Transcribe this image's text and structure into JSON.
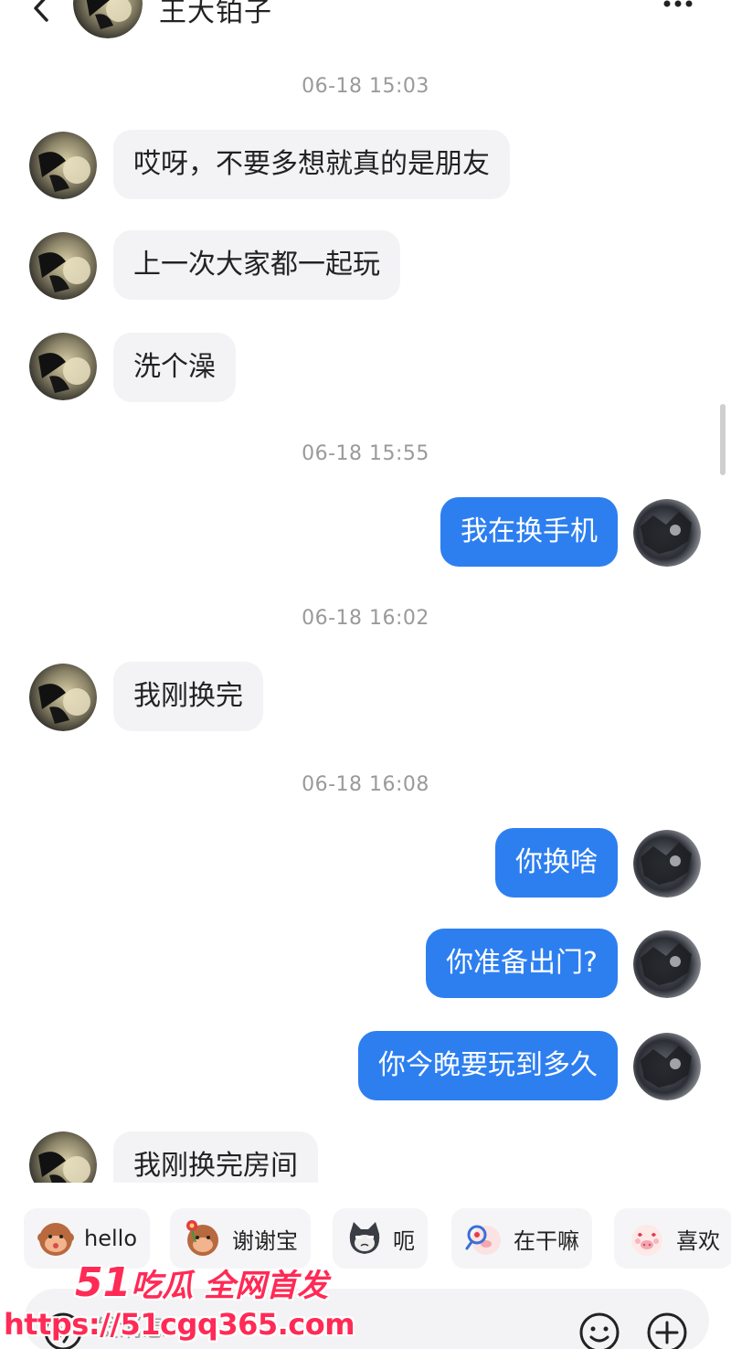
{
  "header": {
    "title": "王大铂子",
    "back_icon": "chevron-left-icon",
    "more_icon": "more-dots-icon"
  },
  "messages": [
    {
      "type": "timestamp",
      "text": "06-18 15:03"
    },
    {
      "type": "in",
      "text": "哎呀，不要多想就真的是朋友"
    },
    {
      "type": "in",
      "text": "上一次大家都一起玩"
    },
    {
      "type": "in",
      "text": "洗个澡"
    },
    {
      "type": "timestamp",
      "text": "06-18 15:55"
    },
    {
      "type": "out",
      "text": "我在换手机"
    },
    {
      "type": "timestamp",
      "text": "06-18 16:02"
    },
    {
      "type": "in",
      "text": "我刚换完"
    },
    {
      "type": "timestamp",
      "text": "06-18 16:08"
    },
    {
      "type": "out",
      "text": "你换啥"
    },
    {
      "type": "out",
      "text": "你准备出门?"
    },
    {
      "type": "out",
      "text": "你今晚要玩到多久"
    },
    {
      "type": "in",
      "text": "我刚换完房间"
    }
  ],
  "quick_replies": [
    {
      "label": "hello",
      "icon": "monkey-sticker-icon"
    },
    {
      "label": "谢谢宝",
      "icon": "monkey-flower-sticker-icon"
    },
    {
      "label": "呃",
      "icon": "cat-sticker-icon"
    },
    {
      "label": "在干嘛",
      "icon": "pig-magnifier-sticker-icon"
    },
    {
      "label": "喜欢",
      "icon": "pig-love-sticker-icon"
    }
  ],
  "input": {
    "placeholder": "发消息",
    "voice_icon": "voice-icon",
    "emoji_icon": "emoji-icon",
    "plus_icon": "plus-icon"
  },
  "watermark": {
    "num": "51",
    "text": "吃瓜 全网首发",
    "url": "https://51cgq365.com"
  },
  "colors": {
    "outgoing_bubble": "#2d7ff0",
    "incoming_bubble": "#f3f3f6",
    "timestamp": "#9a9a9a",
    "watermark": "#ff2a55"
  }
}
